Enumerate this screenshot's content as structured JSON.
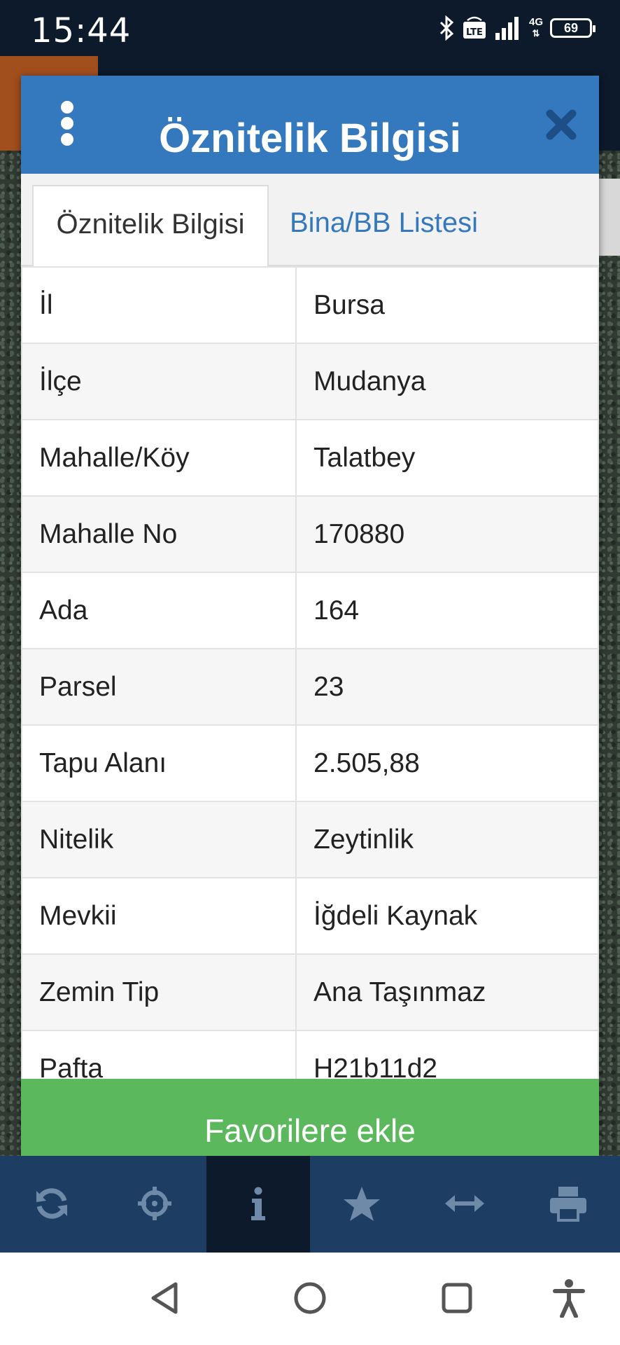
{
  "status_bar": {
    "time": "15:44",
    "battery": "69",
    "network": "4G",
    "icons": [
      "bluetooth-icon",
      "volte-icon",
      "signal-icon",
      "battery-icon"
    ]
  },
  "modal": {
    "title": "Öznitelik Bilgisi",
    "icons": [
      "more-vertical-icon",
      "close-icon"
    ],
    "tabs": [
      {
        "label": "Öznitelik Bilgisi",
        "active": true
      },
      {
        "label": "Bina/BB Listesi",
        "active": false
      }
    ],
    "rows": [
      {
        "label": "İl",
        "value": "Bursa"
      },
      {
        "label": "İlçe",
        "value": "Mudanya"
      },
      {
        "label": "Mahalle/Köy",
        "value": "Talatbey"
      },
      {
        "label": "Mahalle No",
        "value": "170880"
      },
      {
        "label": "Ada",
        "value": "164"
      },
      {
        "label": "Parsel",
        "value": "23"
      },
      {
        "label": "Tapu Alanı",
        "value": "2.505,88"
      },
      {
        "label": "Nitelik",
        "value": "Zeytinlik"
      },
      {
        "label": "Mevkii",
        "value": "İğdeli Kaynak"
      },
      {
        "label": "Zemin Tip",
        "value": "Ana Taşınmaz"
      },
      {
        "label": "Pafta",
        "value": "H21b11d2"
      }
    ],
    "favorite_label": "Favorilere ekle"
  },
  "toolbar": {
    "items": [
      {
        "icon": "refresh-icon",
        "active": false
      },
      {
        "icon": "crosshair-icon",
        "active": false
      },
      {
        "icon": "info-icon",
        "active": true
      },
      {
        "icon": "star-icon",
        "active": false
      },
      {
        "icon": "measure-arrows-icon",
        "active": false
      },
      {
        "icon": "print-icon",
        "active": false
      }
    ]
  },
  "nav_bar": {
    "icons": [
      "back-icon",
      "home-icon",
      "recents-icon",
      "accessibility-icon"
    ]
  },
  "colors": {
    "header_blue": "#3478be",
    "favorite_green": "#5cb85c",
    "toolbar_blue": "#1d3d63",
    "status_bar": "#0c1a2b",
    "toolbar_icon": "#6e8aa8"
  }
}
